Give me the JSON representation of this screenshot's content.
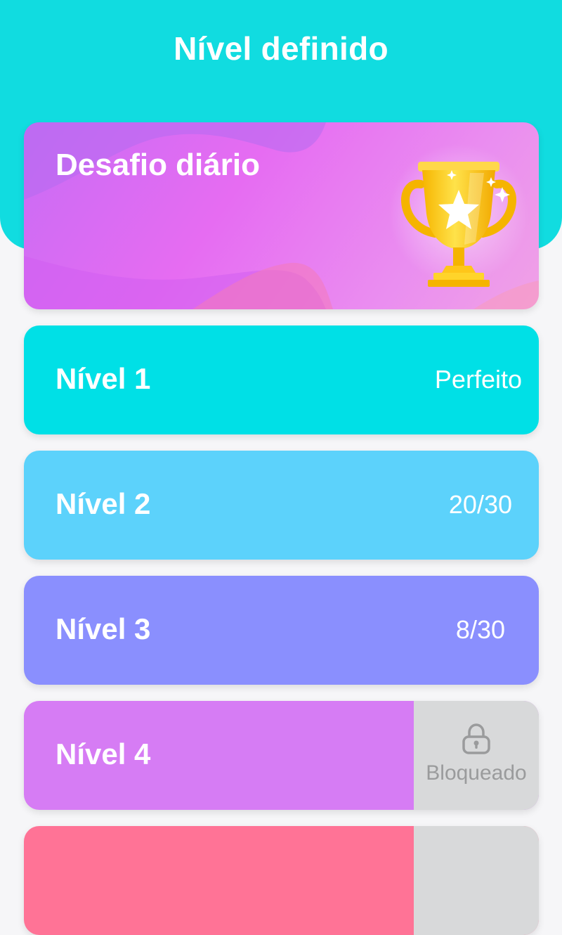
{
  "header": {
    "title": "Nível definido"
  },
  "daily_challenge": {
    "label": "Desafio diário",
    "icon": "trophy-icon"
  },
  "levels": [
    {
      "label": "Nível 1",
      "status": "Perfeito",
      "color": "#00e0e6"
    },
    {
      "label": "Nível 2",
      "status": "20/30",
      "color": "#5cd2fb"
    },
    {
      "label": "Nível 3",
      "status": "8/30",
      "color": "#8a8ffe"
    },
    {
      "label": "Nível 4",
      "status": "Bloqueado",
      "locked": true,
      "icon": "lock-icon",
      "color": "#d67cf4"
    },
    {
      "label": "",
      "locked": true,
      "color": "#ff7396"
    }
  ]
}
